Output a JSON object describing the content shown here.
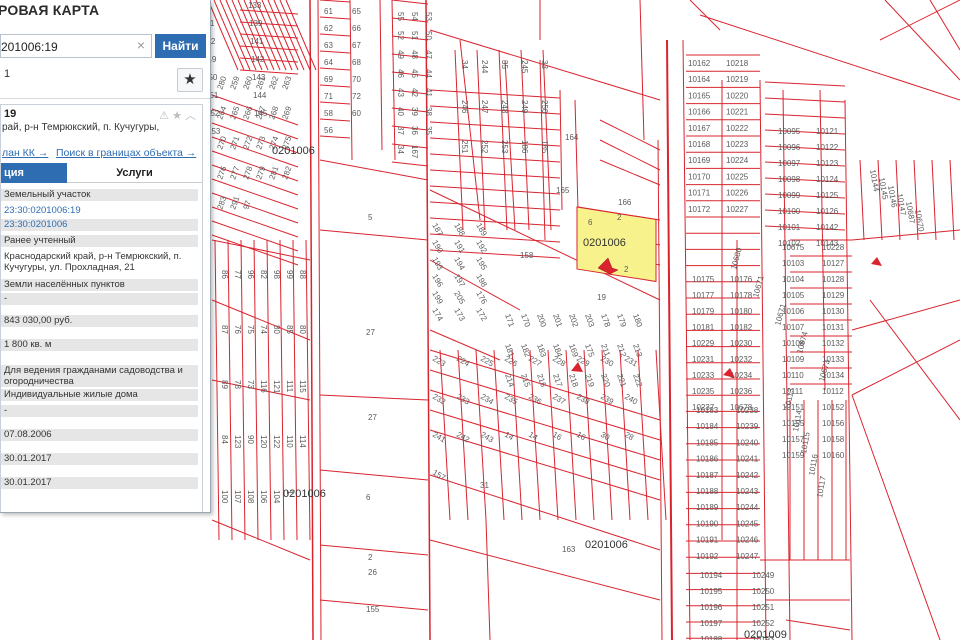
{
  "colors": {
    "boundary": "#d9242e",
    "highlight": "#f8f28c",
    "accent": "#2f6db3",
    "row_grey": "#e6e6e6"
  },
  "panel": {
    "title": "РОВАЯ КАРТА",
    "search_value": "201006:19",
    "search_button": "Найти",
    "result_count": "1",
    "favorite_icon": "star-icon",
    "object": {
      "number": "19",
      "address_line": "рай, р-н Темрюкский, п. Кучугуры,",
      "links": [
        "лан КК →",
        "Поиск в границах объекта →"
      ],
      "tabs": [
        "ция",
        "Услуги"
      ],
      "rows": [
        "Земельный участок",
        "23:30:0201006:19",
        "23:30:0201006",
        "Ранее учтенный",
        "Краснодарский край, р-н Темрюкский, п. Кучугуры, ул. Прохладная, 21",
        "Земли населённых пунктов",
        "-",
        "843 030,00 руб.",
        "1 800 кв. м",
        "Для ведения гражданами садоводства и огородничества",
        "Индивидуальные жилые дома",
        "-",
        "07.08.2006",
        "30.01.2017",
        "30.01.2017"
      ]
    }
  },
  "map": {
    "quarter_labels": [
      "0201006",
      "0201006",
      "0201006",
      "0201006",
      "0201009"
    ],
    "parcels_left": [
      "3",
      "133",
      "131",
      "139",
      "132",
      "141",
      "149",
      "142",
      "150",
      "143",
      "151",
      "144",
      "152",
      "145",
      "153",
      "280",
      "259",
      "260",
      "261",
      "262",
      "263",
      "264",
      "265",
      "266",
      "267",
      "268",
      "269",
      "270",
      "271",
      "272",
      "273",
      "274",
      "275",
      "276",
      "277",
      "278",
      "279",
      "281",
      "282",
      "283",
      "291",
      "97",
      "86",
      "77",
      "96",
      "82",
      "98",
      "99",
      "88",
      "87",
      "76",
      "75",
      "74",
      "80",
      "85",
      "80",
      "89",
      "78",
      "73",
      "116",
      "121",
      "111",
      "115",
      "84",
      "123",
      "90",
      "120",
      "122",
      "110",
      "114",
      "100",
      "107",
      "108",
      "106",
      "104",
      "1"
    ],
    "parcels_mid": [
      "61",
      "65",
      "62",
      "66",
      "63",
      "67",
      "64",
      "68",
      "69",
      "70",
      "71",
      "72",
      "58",
      "60",
      "56",
      "55",
      "54",
      "53",
      "52",
      "51",
      "50",
      "49",
      "48",
      "47",
      "46",
      "45",
      "44",
      "43",
      "42",
      "41",
      "40",
      "39",
      "38",
      "37",
      "36",
      "35",
      "34",
      "167",
      "5",
      "27",
      "27",
      "6",
      "26",
      "155",
      "2"
    ],
    "parcels_center": [
      "34",
      "244",
      "35",
      "245",
      "33",
      "246",
      "247",
      "248",
      "249",
      "250",
      "251",
      "252",
      "253",
      "186",
      "185",
      "187",
      "188",
      "189",
      "190",
      "191",
      "192",
      "193",
      "194",
      "195",
      "196",
      "197",
      "198",
      "199",
      "205",
      "176",
      "174",
      "173",
      "172",
      "171",
      "170",
      "200",
      "201",
      "202",
      "203",
      "178",
      "179",
      "180",
      "181",
      "182",
      "183",
      "184",
      "169",
      "175",
      "211",
      "212",
      "213",
      "214",
      "215",
      "216",
      "217",
      "218",
      "219",
      "220",
      "221",
      "222",
      "223",
      "224",
      "225",
      "226",
      "227",
      "228",
      "229",
      "230",
      "231",
      "232",
      "233",
      "234",
      "235",
      "236",
      "237",
      "238",
      "239",
      "240",
      "241",
      "242",
      "243",
      "14",
      "14",
      "16",
      "16",
      "30",
      "28",
      "157",
      "158",
      "19",
      "31",
      "163",
      "164",
      "165",
      "166",
      "2",
      "6",
      "2"
    ],
    "parcels_right": [
      "10162",
      "10218",
      "10164",
      "10219",
      "10165",
      "10220",
      "10166",
      "10221",
      "10167",
      "10222",
      "10168",
      "10223",
      "10169",
      "10224",
      "10170",
      "10225",
      "10171",
      "10226",
      "10172",
      "10227",
      "10095",
      "10096",
      "10097",
      "10098",
      "10099",
      "10100",
      "10101",
      "10102",
      "10121",
      "10122",
      "10123",
      "10124",
      "10125",
      "10126",
      "10142",
      "10143",
      "10144",
      "10145",
      "10146",
      "10147",
      "10687",
      "10670",
      "10675",
      "10228",
      "10103",
      "10127",
      "10104",
      "10128",
      "10105",
      "10129",
      "10106",
      "10130",
      "10107",
      "10131",
      "10108",
      "10132",
      "10109",
      "10133",
      "10110",
      "10134",
      "10111",
      "10112",
      "10151",
      "10152",
      "10155",
      "10156",
      "10157",
      "10158",
      "10159",
      "10160",
      "10175",
      "10176",
      "10177",
      "10178",
      "10179",
      "10180",
      "10181",
      "10182",
      "10229",
      "10230",
      "10231",
      "10232",
      "10233",
      "10234",
      "10235",
      "10236",
      "10237",
      "10678",
      "10680",
      "10671",
      "10671",
      "10674",
      "10673",
      "10183",
      "10238",
      "10184",
      "10239",
      "10185",
      "10240",
      "10186",
      "10241",
      "10187",
      "10242",
      "10188",
      "10243",
      "10189",
      "10244",
      "10190",
      "10245",
      "10191",
      "10246",
      "10192",
      "10247",
      "10113",
      "10114",
      "10115",
      "10116",
      "10117",
      "10194",
      "10249",
      "10195",
      "10250",
      "10196",
      "10251",
      "10197",
      "10252",
      "10188",
      "10193",
      "10744"
    ]
  }
}
